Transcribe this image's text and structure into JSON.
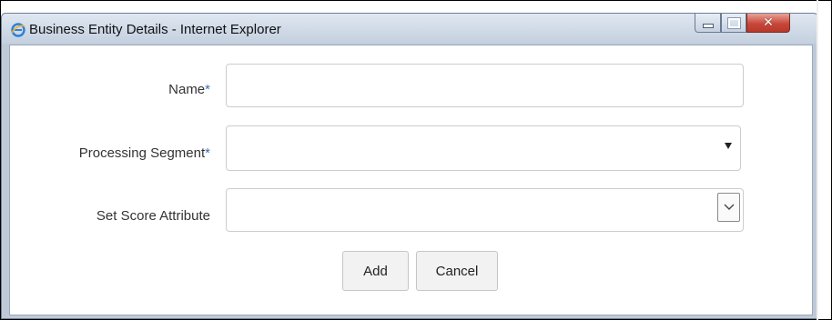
{
  "window": {
    "title": "Business Entity Details - Internet Explorer",
    "buttons": {
      "minimize": "minimize-icon",
      "maximize": "maximize-icon",
      "close": "close-icon"
    }
  },
  "form": {
    "name_label": "Name",
    "name_value": "",
    "segment_label": "Processing Segment",
    "segment_value": "",
    "score_label": "Set Score Attribute",
    "score_value": "",
    "required_marker": "*"
  },
  "actions": {
    "add_label": "Add",
    "cancel_label": "Cancel"
  },
  "colors": {
    "required": "#3a6fb7",
    "close_button": "#c7483a",
    "titlebar": "#c4d0df"
  }
}
